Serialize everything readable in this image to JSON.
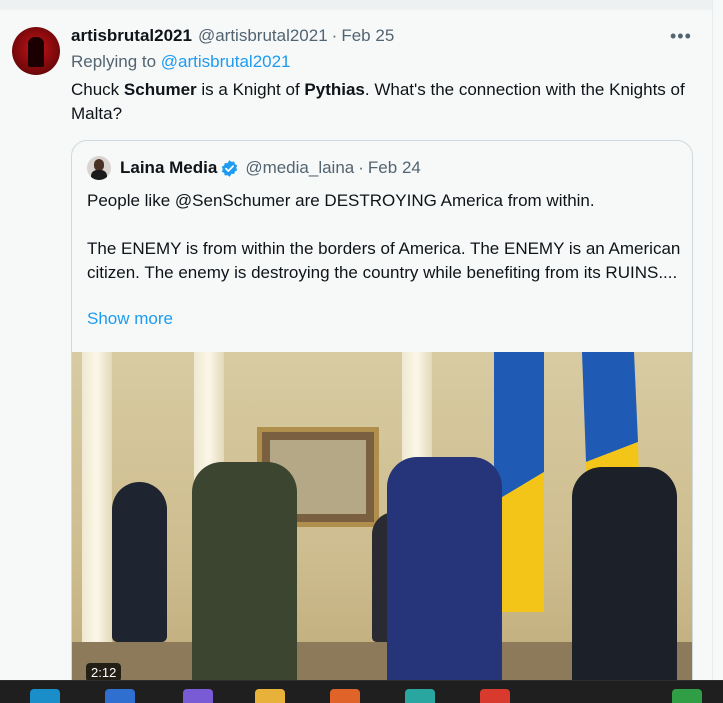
{
  "tweet": {
    "author_name": "artisbrutal2021",
    "author_handle": "@artisbrutal2021",
    "separator": "·",
    "date": "Feb 25",
    "more_icon": "more-horizontal-icon",
    "replying_to_label": "Replying to",
    "replying_to_handle": "@artisbrutal2021",
    "text_parts": [
      "Chuck ",
      "Schumer",
      " is a Knight of ",
      "Pythias",
      ".  What's the connection with the Knights of Malta?"
    ]
  },
  "quote": {
    "author_name": "Laina Media",
    "author_handle": "@media_laina",
    "verified_icon": "verified-badge-icon",
    "separator": "·",
    "date": "Feb 24",
    "paragraphs": [
      "People like @SenSchumer are DESTROYING America from within.",
      "The ENEMY is from within the borders  of America. The ENEMY is an American citizen. The enemy is destroying the country while benefiting from its RUINS...."
    ],
    "show_more_label": "Show more",
    "video_duration": "2:12"
  },
  "colors": {
    "accent": "#1d9bf0",
    "secondary_text": "#536471",
    "background": "#f7f9f9"
  },
  "taskbar": {
    "icons": [
      "edge-icon",
      "app-icon",
      "copilot-icon",
      "file-explorer-icon",
      "firefox-icon",
      "paint-icon",
      "chrome-icon",
      "app-icon-green"
    ]
  }
}
